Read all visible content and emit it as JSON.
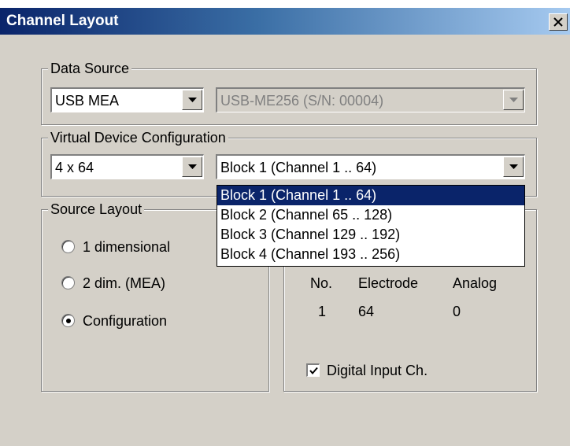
{
  "window": {
    "title": "Channel Layout"
  },
  "data_source": {
    "legend": "Data Source",
    "type_value": "USB MEA",
    "device_value": "USB-ME256  (S/N: 00004)"
  },
  "virtual_device": {
    "legend": "Virtual Device Configuration",
    "config_value": "4 x 64",
    "block_value": "Block 1 (Channel 1 .. 64)",
    "block_options": [
      "Block 1 (Channel 1 .. 64)",
      "Block 2 (Channel 65 .. 128)",
      "Block 3 (Channel 129 .. 192)",
      "Block 4 (Channel 193 .. 256)"
    ],
    "selected_index": 0
  },
  "source_layout": {
    "legend": "Source Layout",
    "options": [
      "1 dimensional",
      "2 dim. (MEA)",
      "Configuration"
    ],
    "selected_index": 2
  },
  "channel_table": {
    "headers": [
      "No.",
      "Electrode",
      "Analog"
    ],
    "row": [
      "1",
      "64",
      "0"
    ]
  },
  "digital_input": {
    "label": "Digital Input Ch.",
    "checked": true
  }
}
